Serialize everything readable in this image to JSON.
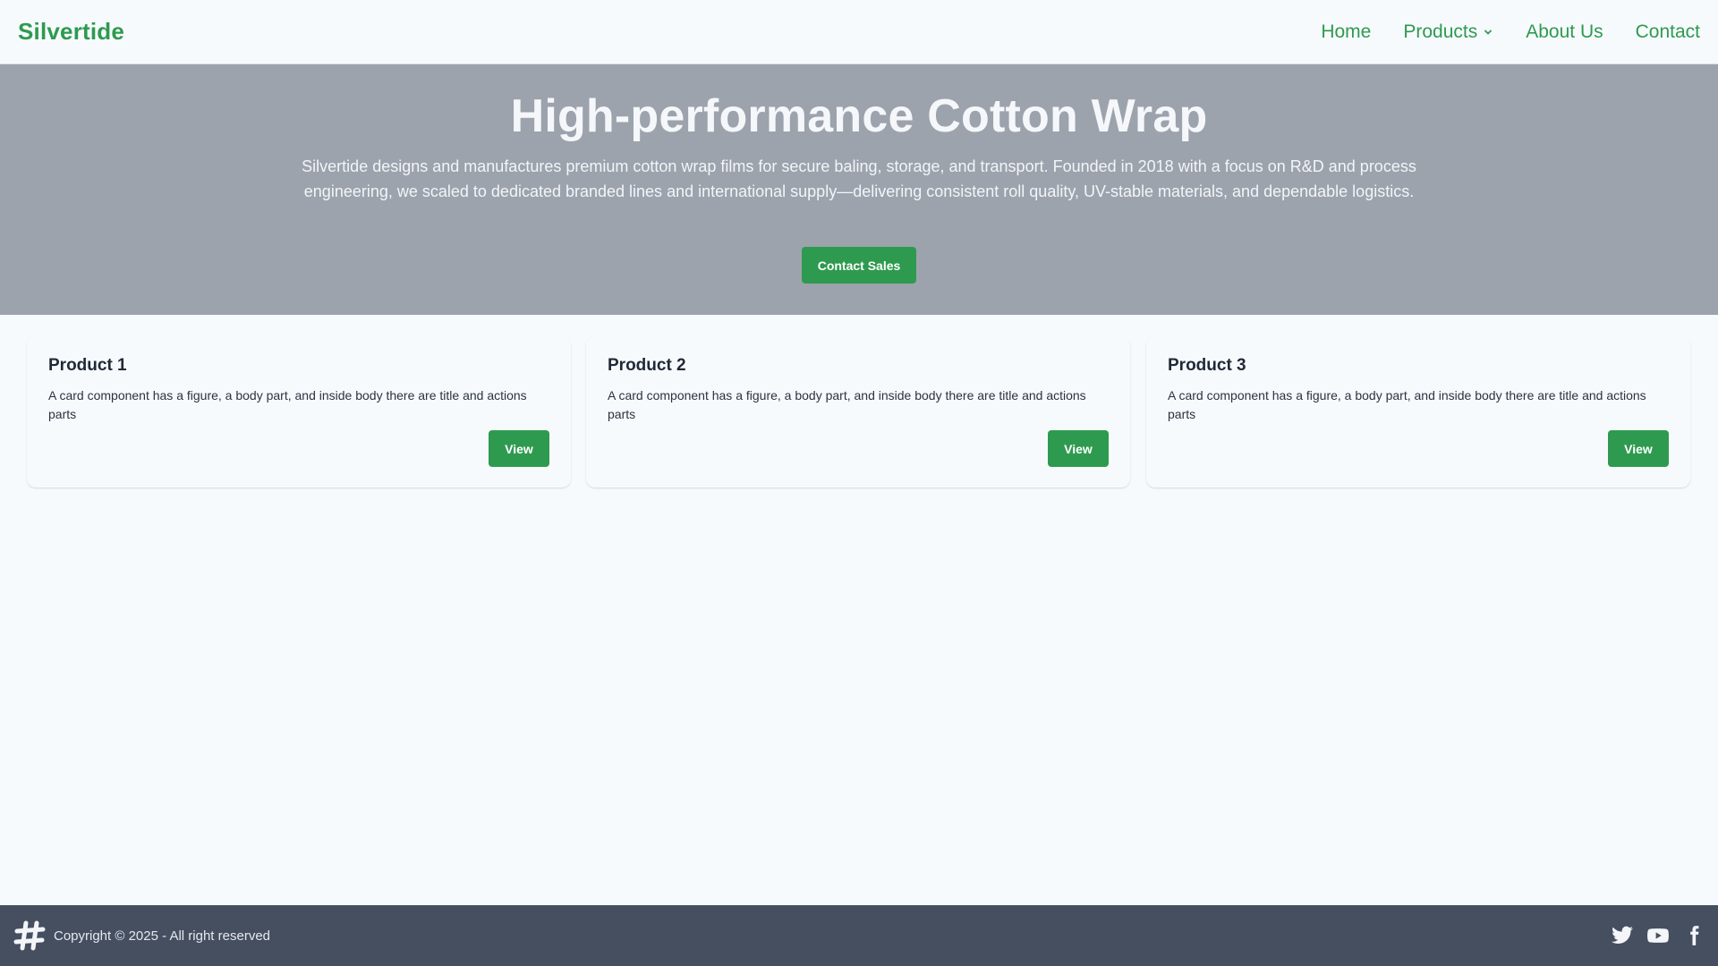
{
  "navbar": {
    "brand": "Silvertide",
    "links": [
      {
        "label": "Home"
      },
      {
        "label": "Products",
        "icon": "chevron-down-icon"
      },
      {
        "label": "About Us"
      },
      {
        "label": "Contact"
      }
    ]
  },
  "hero": {
    "title": "High-performance Cotton Wrap",
    "description": "Silvertide designs and manufactures premium cotton wrap films for secure baling, storage, and transport. Founded in 2018 with a focus on R&D and process engineering, we scaled to dedicated branded lines and international supply—delivering consistent roll quality, UV-stable materials, and dependable logistics.",
    "cta_label": "Contact Sales"
  },
  "products": [
    {
      "title": "Product 1",
      "description": "A card component has a figure, a body part, and inside body there are title and actions parts",
      "button_label": "View"
    },
    {
      "title": "Product 2",
      "description": "A card component has a figure, a body part, and inside body there are title and actions parts",
      "button_label": "View"
    },
    {
      "title": "Product 3",
      "description": "A card component has a figure, a body part, and inside body there are title and actions parts",
      "button_label": "View"
    }
  ],
  "footer": {
    "logo_icon": "hashtag-logo-icon",
    "copyright": "Copyright © 2025 - All right reserved",
    "social": [
      "twitter-icon",
      "youtube-icon",
      "facebook-icon"
    ]
  },
  "colors": {
    "brand": "#2e9a4f",
    "hero_bg": "#9ca3ad",
    "footer_bg": "#454f60",
    "page_bg": "#f7fafd"
  }
}
